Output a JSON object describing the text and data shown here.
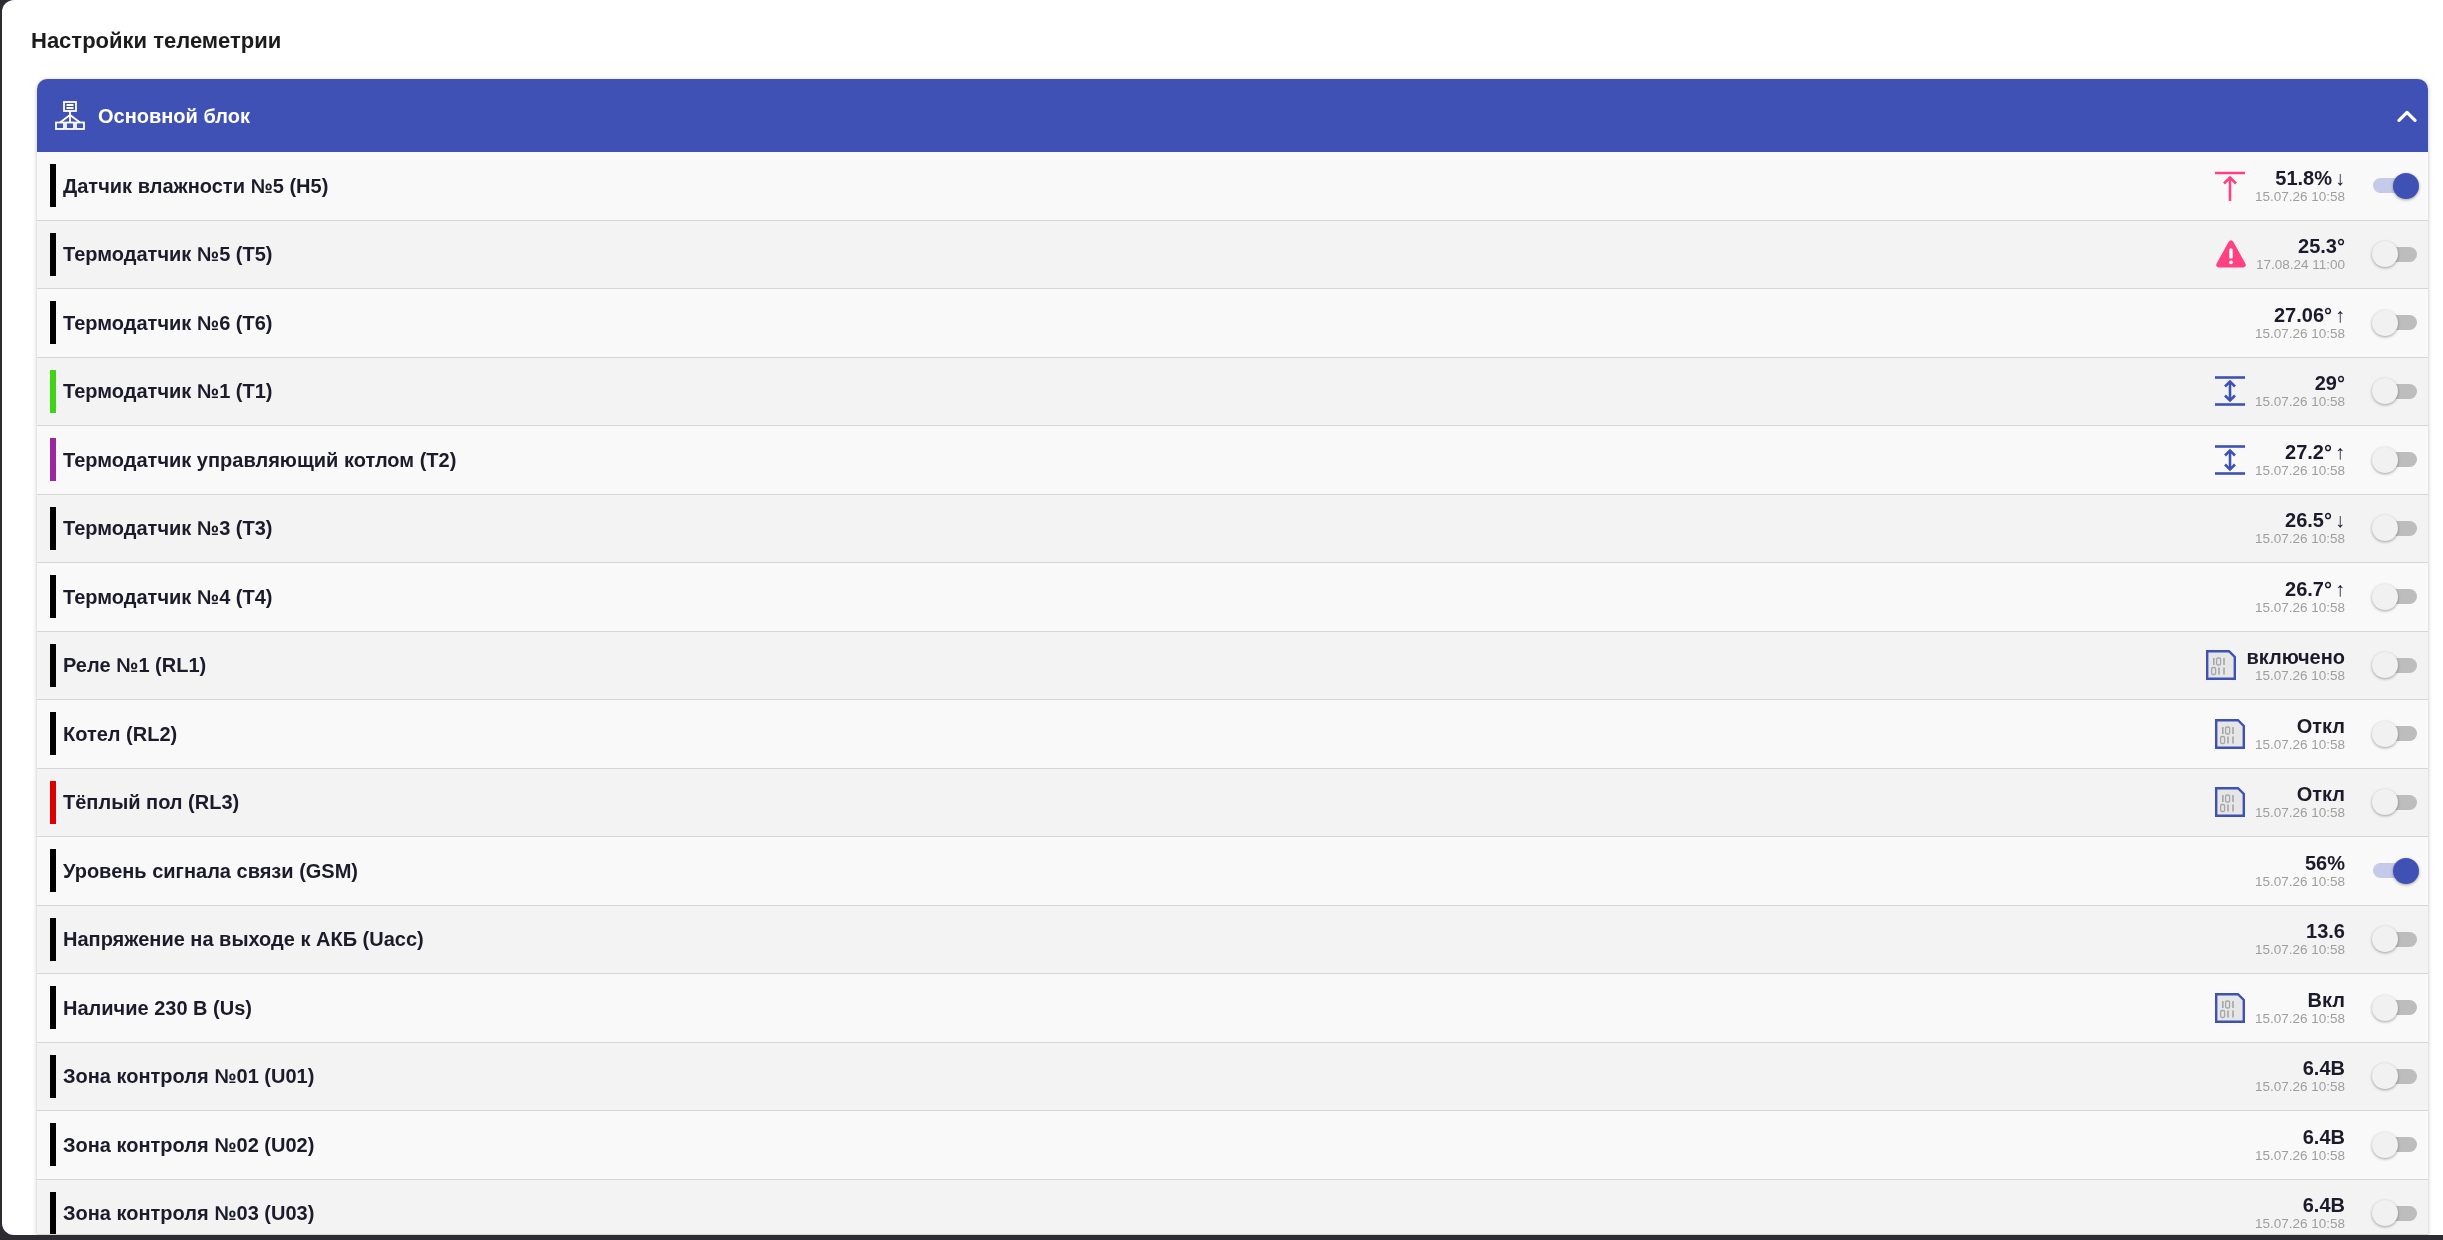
{
  "title": "Настройки телеметрии",
  "section": {
    "title": "Основной блок",
    "expanded": true,
    "rows": [
      {
        "kind": "overlimit",
        "name": "Датчик влажности №5 (H5)",
        "color": "#000000",
        "value": "51.8%",
        "trend": "↓",
        "time": "15.07.26 10:58",
        "on": true
      },
      {
        "kind": "alarm",
        "name": "Термодатчик №5 (T5)",
        "color": "#000000",
        "value": "25.3°",
        "time": "17.08.24 11:00",
        "on": false
      },
      {
        "kind": "plain",
        "name": "Термодатчик №6 (T6)",
        "color": "#000000",
        "value": "27.06°",
        "trend": "↑",
        "time": "15.07.26 10:58",
        "on": false
      },
      {
        "kind": "range",
        "name": "Термодатчик №1 (T1)",
        "color": "#41d317",
        "value": "29°",
        "time": "15.07.26 10:58",
        "on": false
      },
      {
        "kind": "range",
        "name": "Термодатчик управляющий котлом (T2)",
        "color": "#9b27a0",
        "value": "27.2°",
        "trend": "↑",
        "time": "15.07.26 10:58",
        "on": false
      },
      {
        "kind": "plain",
        "name": "Термодатчик №3 (T3)",
        "color": "#000000",
        "value": "26.5°",
        "trend": "↓",
        "time": "15.07.26 10:58",
        "on": false
      },
      {
        "kind": "plain",
        "name": "Термодатчик №4 (T4)",
        "color": "#000000",
        "value": "26.7°",
        "trend": "↑",
        "time": "15.07.26 10:58",
        "on": false
      },
      {
        "kind": "binary",
        "name": "Реле №1 (RL1)",
        "color": "#000000",
        "value": "включено",
        "time": "15.07.26 10:58",
        "on": false
      },
      {
        "kind": "binary",
        "name": "Котел (RL2)",
        "color": "#000000",
        "value": "Откл",
        "time": "15.07.26 10:58",
        "on": false
      },
      {
        "kind": "binary",
        "name": "Тёплый пол (RL3)",
        "color": "#dd0000",
        "value": "Откл",
        "time": "15.07.26 10:58",
        "on": false
      },
      {
        "kind": "plain",
        "name": "Уровень сигнала связи (GSM)",
        "color": "#000000",
        "value": "56%",
        "time": "15.07.26 10:58",
        "on": true
      },
      {
        "kind": "plain",
        "name": "Напряжение на выходе к АКБ (Uacc)",
        "color": "#000000",
        "value": "13.6",
        "time": "15.07.26 10:58",
        "on": false
      },
      {
        "kind": "binary",
        "name": "Наличие 230 В (Us)",
        "color": "#000000",
        "value": "Вкл",
        "time": "15.07.26 10:58",
        "on": false
      },
      {
        "kind": "plain",
        "name": "Зона контроля №01 (U01)",
        "color": "#000000",
        "value": "6.4В",
        "time": "15.07.26 10:58",
        "on": false
      },
      {
        "kind": "plain",
        "name": "Зона контроля №02 (U02)",
        "color": "#000000",
        "value": "6.4В",
        "time": "15.07.26 10:58",
        "on": false
      },
      {
        "kind": "plain",
        "name": "Зона контроля №03 (U03)",
        "color": "#000000",
        "value": "6.4В",
        "time": "15.07.26 10:58",
        "on": false
      }
    ]
  }
}
